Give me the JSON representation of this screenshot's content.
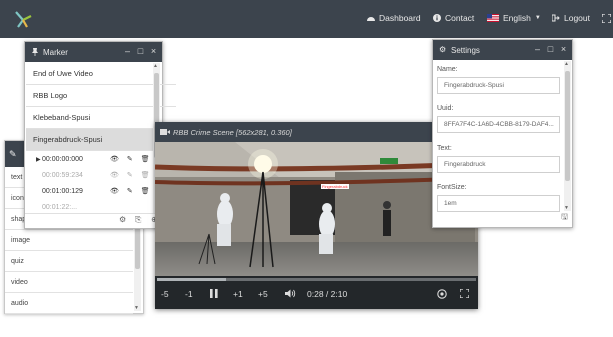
{
  "nav": {
    "dashboard": "Dashboard",
    "contact": "Contact",
    "language": "English",
    "logout": "Logout"
  },
  "marker_panel": {
    "title": "Marker",
    "items": [
      "End of Uwe Video",
      "RBB Logo",
      "Klebeband-Spusi",
      "Fingerabdruck-Spusi"
    ],
    "timestamps": [
      {
        "time": "00:00:00:000"
      },
      {
        "time": "00:00:59:234"
      },
      {
        "time": "00:01:00:129"
      },
      {
        "time": "00:01:22:..."
      }
    ]
  },
  "left_list": {
    "items": [
      "text",
      "icon",
      "shape",
      "image",
      "quiz",
      "video",
      "audio"
    ]
  },
  "video": {
    "title": "RBB Crime Scene [562x281, 0.360]",
    "controls": {
      "back5": "-5",
      "back1": "-1",
      "fwd1": "+1",
      "fwd5": "+5",
      "time": "0:28 / 2:10"
    },
    "progress": 0.215,
    "marker_label": "Fingerabdruck"
  },
  "settings": {
    "title": "Settings",
    "name_label": "Name:",
    "name_value": "Fingerabdruck-Spusi",
    "uuid_label": "Uuid:",
    "uuid_value": "8FFA7F4C-1A6D-4CBB-8179-DAF4...",
    "text_label": "Text:",
    "text_value": "Fingerabdruck",
    "fontsize_label": "FontSize:",
    "fontsize_value": "1em"
  },
  "colors": {
    "header": "#3c444d",
    "accent": "#d9232d"
  }
}
